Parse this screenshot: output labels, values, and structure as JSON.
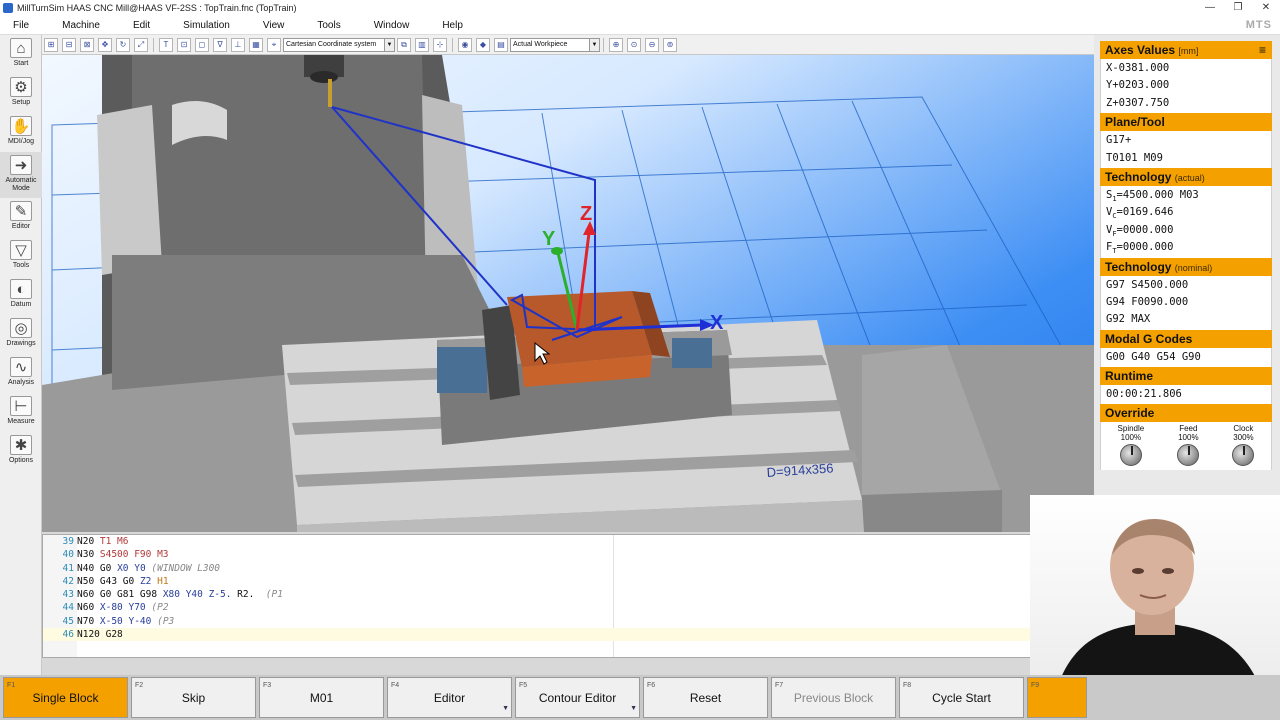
{
  "window": {
    "title": "MillTurnSim HAAS CNC Mill@HAAS VF-2SS : TopTrain.fnc (TopTrain)",
    "controls": [
      "—",
      "❐",
      "✕"
    ]
  },
  "menu": {
    "items": [
      "File",
      "Machine",
      "Edit",
      "Simulation",
      "View",
      "Tools",
      "Window",
      "Help"
    ],
    "logo": "MTS"
  },
  "left_toolbar": {
    "items": [
      {
        "label": "Start",
        "icon": "home-icon",
        "glyph": "⌂"
      },
      {
        "label": "Setup",
        "icon": "setup-icon",
        "glyph": "⚙"
      },
      {
        "label": "MDI/Jog",
        "icon": "hand-icon",
        "glyph": "✋"
      },
      {
        "label": "Automatic Mode",
        "icon": "automatic-mode-icon",
        "glyph": "➜"
      },
      {
        "label": "Editor",
        "icon": "editor-icon",
        "glyph": "✎"
      },
      {
        "label": "Tools",
        "icon": "tools-icon",
        "glyph": "▽"
      },
      {
        "label": "Datum",
        "icon": "datum-icon",
        "glyph": "◐"
      },
      {
        "label": "Drawings",
        "icon": "drawings-icon",
        "glyph": "◎"
      },
      {
        "label": "Analysis",
        "icon": "analysis-icon",
        "glyph": "∿"
      },
      {
        "label": "Measure",
        "icon": "measure-icon",
        "glyph": "⊢"
      },
      {
        "label": "Options",
        "icon": "options-icon",
        "glyph": "✱"
      }
    ]
  },
  "top_toolbar": {
    "coordinate_system": "Cartesian Coordinate system",
    "workpiece": "Actual Workpiece"
  },
  "viewport": {
    "table_label": "D=914x356",
    "axis_x": "X",
    "axis_y": "Y",
    "axis_z": "Z"
  },
  "editor": {
    "lines": [
      {
        "num": "39",
        "tokens": [
          [
            "n",
            "N20 "
          ],
          [
            "r",
            "T1 M6"
          ]
        ]
      },
      {
        "num": "40",
        "tokens": [
          [
            "n",
            "N30 "
          ],
          [
            "r",
            "S4500 F90 M3"
          ]
        ]
      },
      {
        "num": "41",
        "tokens": [
          [
            "n",
            "N40 "
          ],
          [
            "k",
            "G0 "
          ],
          [
            "b",
            "X0 Y0 "
          ],
          [
            "c",
            "(WINDOW L300"
          ]
        ]
      },
      {
        "num": "42",
        "tokens": [
          [
            "n",
            "N50 "
          ],
          [
            "k",
            "G43 G0 "
          ],
          [
            "b",
            "Z2 "
          ],
          [
            "o",
            "H1"
          ]
        ]
      },
      {
        "num": "43",
        "tokens": [
          [
            "n",
            "N60 "
          ],
          [
            "k",
            "G0 G81 G98 "
          ],
          [
            "b",
            "X80 Y40 Z-5. "
          ],
          [
            "k",
            "R2.  "
          ],
          [
            "c",
            "(P1"
          ]
        ]
      },
      {
        "num": "44",
        "tokens": [
          [
            "n",
            "N60 "
          ],
          [
            "b",
            "X-80 Y70 "
          ],
          [
            "c",
            "(P2"
          ]
        ]
      },
      {
        "num": "45",
        "tokens": [
          [
            "n",
            "N70 "
          ],
          [
            "b",
            "X-50 Y-40 "
          ],
          [
            "c",
            "(P3"
          ]
        ]
      },
      {
        "num": "46",
        "tokens": [
          [
            "n",
            "N120 G28"
          ]
        ],
        "current": true
      }
    ]
  },
  "right_panel": {
    "axes": {
      "title": "Axes Values",
      "unit": "[mm]",
      "menu_icon": "≡",
      "x": "X-0381.000",
      "y": "Y+0203.000",
      "z": "Z+0307.750"
    },
    "plane_tool": {
      "title": "Plane/Tool",
      "plane": "G17+",
      "tool": "T0101 M09"
    },
    "tech_actual": {
      "title": "Technology",
      "qualifier": "(actual)",
      "s_label": "S",
      "s_sub": "1",
      "s_value": "=4500.000 M03",
      "vc_label": "V",
      "vc_sub": "C",
      "vc_value": "=0169.646",
      "vf_label": "V",
      "vf_sub": "F",
      "vf_value": "=0000.000",
      "ft_label": "F",
      "ft_sub": "T",
      "ft_value": "=0000.000"
    },
    "tech_nominal": {
      "title": "Technology",
      "qualifier": "(nominal)",
      "line1": "G97 S4500.000",
      "line2": "G94 F0090.000",
      "line3": "G92 MAX"
    },
    "modal": {
      "title": "Modal G Codes",
      "codes": "G00 G40 G54 G90"
    },
    "runtime": {
      "title": "Runtime",
      "value": "00:00:21.806"
    },
    "override": {
      "title": "Override",
      "spindle_label": "Spindle",
      "spindle_value": "100%",
      "feed_label": "Feed",
      "feed_value": "100%",
      "clock_label": "Clock",
      "clock_value": "300%"
    }
  },
  "function_keys": [
    {
      "fn": "F1",
      "label": "Single Block",
      "state": "active",
      "dropdown": false
    },
    {
      "fn": "F2",
      "label": "Skip",
      "state": "normal",
      "dropdown": false
    },
    {
      "fn": "F3",
      "label": "M01",
      "state": "normal",
      "dropdown": false
    },
    {
      "fn": "F4",
      "label": "Editor",
      "state": "normal",
      "dropdown": true
    },
    {
      "fn": "F5",
      "label": "Contour Editor",
      "state": "normal",
      "dropdown": true
    },
    {
      "fn": "F6",
      "label": "Reset",
      "state": "normal",
      "dropdown": false
    },
    {
      "fn": "F7",
      "label": "Previous Block",
      "state": "disabled",
      "dropdown": false
    },
    {
      "fn": "F8",
      "label": "Cycle Start",
      "state": "normal",
      "dropdown": false
    },
    {
      "fn": "F9",
      "label": "",
      "state": "active",
      "dropdown": false
    }
  ]
}
